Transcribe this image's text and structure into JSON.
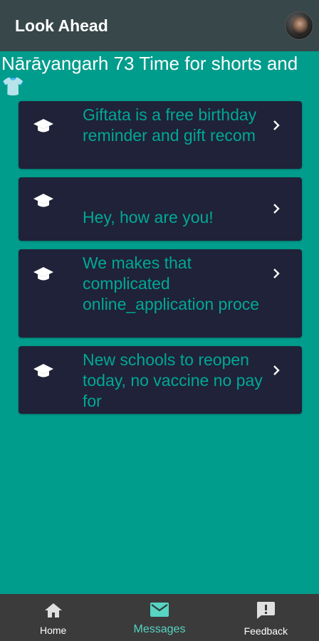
{
  "appbar": {
    "title": "Look Ahead"
  },
  "headline": {
    "text": " Nārāyangarh 73  Time for shorts and ",
    "emoji": "👕"
  },
  "cards": [
    {
      "text": "Giftata is a free birthday reminder and gift recom"
    },
    {
      "text": "Hey, how are you!"
    },
    {
      "text": "We makes that complicated online_application proce"
    },
    {
      "text": "New schools to reopen today, no vaccine no pay for"
    }
  ],
  "nav": {
    "home": "Home",
    "messages": "Messages",
    "feedback": "Feedback"
  },
  "colors": {
    "background": "#009c8c",
    "appbar": "#37474a",
    "card": "#1f2238",
    "card_text": "#00a896",
    "nav_active": "#57d4c2",
    "bottombar": "#3b3b3b"
  }
}
